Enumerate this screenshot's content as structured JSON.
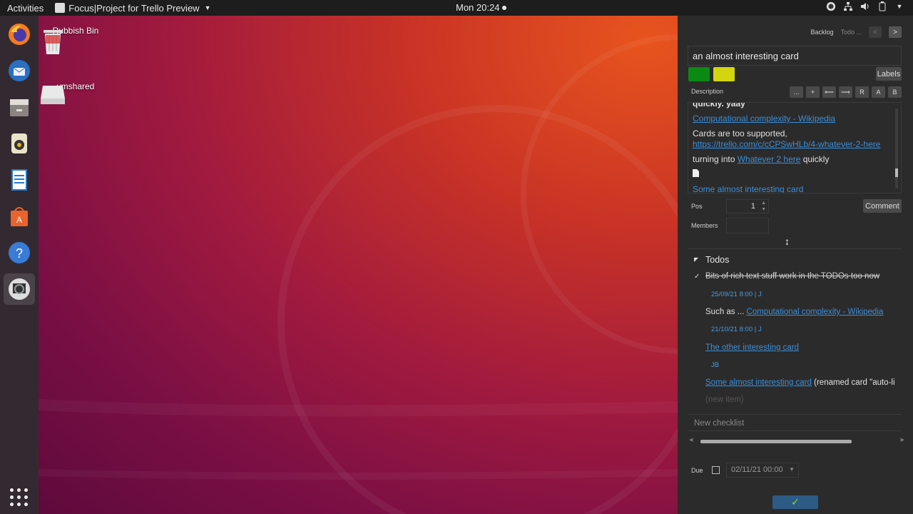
{
  "topbar": {
    "activities": "Activities",
    "app_name": "Focus|Project for Trello Preview",
    "clock": "Mon 20:24"
  },
  "dock": {
    "items": [
      "firefox-icon",
      "thunderbird-icon",
      "files-icon",
      "rhythmbox-icon",
      "writer-icon",
      "software-icon",
      "help-icon",
      "focus-project-icon"
    ]
  },
  "desktop": {
    "icons": [
      {
        "label": "Rubbish Bin"
      },
      {
        "label": "vmshared"
      }
    ]
  },
  "panel": {
    "nav": {
      "backlog": "Backlog",
      "todo": "Todo ...",
      "prev": "<",
      "next": ">"
    },
    "card_title": "an almost interesting card",
    "labels": {
      "green": "#0b8a13",
      "yellow": "#d3d60e",
      "button": "Labels"
    },
    "description_label": "Description",
    "toolbar": [
      "...",
      "+",
      "⟸",
      "⟹",
      "R",
      "A",
      "B"
    ],
    "description": {
      "cut_line": "quickly. yaay",
      "link1": "Computational complexity - Wikipedia",
      "line2_text": "Cards are too supported,",
      "link2": "https://trello.com/c/cCPSwHLb/4-whatever-2-here",
      "line3_prefix": "turning into ",
      "link3": "Whatever 2 here",
      "line3_suffix": " quickly",
      "link4": "Some almost interesting card"
    },
    "pos_label": "Pos",
    "pos_value": "1",
    "comment_button": "Comment",
    "members_label": "Members",
    "todos": {
      "header": "Todos",
      "items": [
        {
          "text": "Bits of rich text stuff work in the TODOs too now",
          "meta": "25/09/21 8:00 | J",
          "checked": true
        },
        {
          "prefix": "Such as ... ",
          "link": "Computational complexity - Wikipedia",
          "meta": "21/10/21 8:00 | J"
        },
        {
          "link": "The other interesting card",
          "meta": "JB"
        },
        {
          "link": "Some almost interesting card",
          "suffix": " (renamed card \"auto-li"
        }
      ],
      "new_item": "(new item)"
    },
    "new_checklist": "New checklist",
    "due_label": "Due",
    "due_value": "02/11/21 00:00",
    "confirm": "✓"
  }
}
